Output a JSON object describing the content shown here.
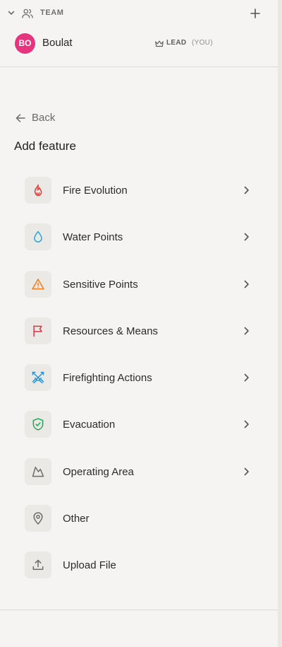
{
  "team": {
    "label": "TEAM",
    "members": [
      {
        "initials": "BO",
        "name": "Boulat",
        "role": "LEAD",
        "self_label": "(YOU)"
      }
    ]
  },
  "nav": {
    "back_label": "Back"
  },
  "panel": {
    "title": "Add feature",
    "items": [
      {
        "label": "Fire Evolution",
        "icon": "flame-icon",
        "color": "#e0403a",
        "has_submenu": true
      },
      {
        "label": "Water Points",
        "icon": "droplet-icon",
        "color": "#22a6d5",
        "has_submenu": true
      },
      {
        "label": "Sensitive Points",
        "icon": "warning-triangle-icon",
        "color": "#ef7d1a",
        "has_submenu": true
      },
      {
        "label": "Resources & Means",
        "icon": "flag-icon",
        "color": "#d6374a",
        "has_submenu": true
      },
      {
        "label": "Firefighting Actions",
        "icon": "crossed-swords-icon",
        "color": "#2196d8",
        "has_submenu": true
      },
      {
        "label": "Evacuation",
        "icon": "shield-check-icon",
        "color": "#23a454",
        "has_submenu": true
      },
      {
        "label": "Operating Area",
        "icon": "mountain-icon",
        "color": "#6d6d6d",
        "has_submenu": true
      },
      {
        "label": "Other",
        "icon": "map-pin-icon",
        "color": "#6d6d6d",
        "has_submenu": false
      },
      {
        "label": "Upload File",
        "icon": "upload-icon",
        "color": "#6d6d6d",
        "has_submenu": false
      }
    ]
  },
  "colors": {
    "avatar_background": "#e5357f",
    "page_background": "#f5f4f2",
    "icon_tile_background": "#ebe9e6"
  }
}
